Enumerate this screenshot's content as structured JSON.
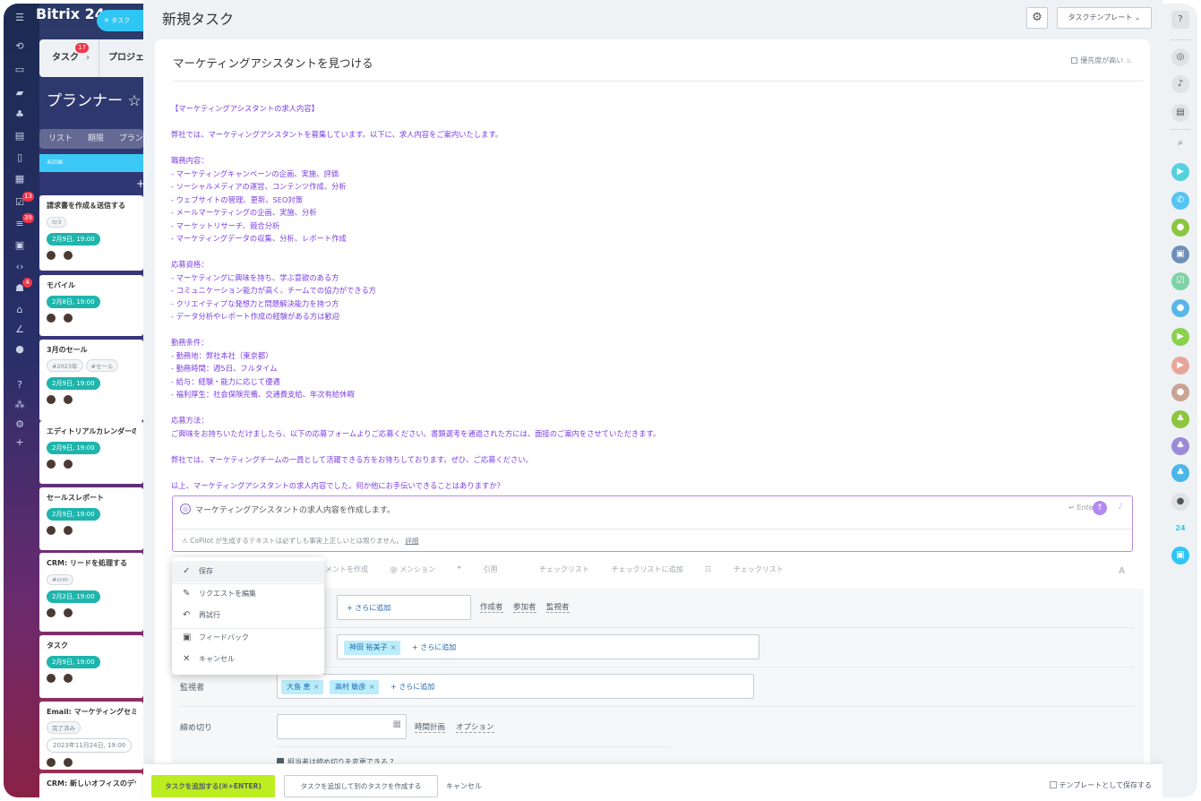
{
  "rail": {
    "brand": "Bitrix 24",
    "chip_label": "タスク",
    "counters": [
      "13",
      "39",
      "4"
    ]
  },
  "planner": {
    "tabs": [
      "タスク",
      "プロジェ"
    ],
    "tab_counter": "17",
    "title": "プランナー",
    "views": "リスト 期限 プラン",
    "column": "未計画",
    "cards": [
      {
        "title": "請求書を作成＆送信する",
        "tag": "0/3",
        "date": "2月9日, 19:00"
      },
      {
        "title": "モバイル",
        "date": "2月8日, 19:00"
      },
      {
        "title": "3月のセール",
        "tags": [
          "#2023年",
          "#セール"
        ],
        "date": "2月9日, 19:00"
      },
      {
        "title": "エディトリアルカレンダーの作",
        "date": "2月9日, 19:00"
      },
      {
        "title": "セールスレポート",
        "date": "2月9日, 19:00"
      },
      {
        "title": "CRM: リードを処理する",
        "tag": "#crm",
        "date": "2月2日, 19:00"
      },
      {
        "title": "タスク",
        "date": "2月9日, 19:00"
      },
      {
        "title": "Email: マーケティングセミナ",
        "tag": "完了済み",
        "date": "2023年11月24日, 19:00"
      },
      {
        "title": "CRM: 新しいオフィスのデザ"
      }
    ]
  },
  "main": {
    "header": "新規タスク",
    "template_button": "タスクテンプレート",
    "task_title": "マーケティングアシスタントを見つける",
    "priority_label": "優先度が高い",
    "ai_text": "【マーケティングアシスタントの求人内容】\n\n弊社では、マーケティングアシスタントを募集しています。以下に、求人内容をご案内いたします。\n\n職務内容：\n- マーケティングキャンペーンの企画、実施、評価\n- ソーシャルメディアの運営、コンテンツ作成、分析\n- ウェブサイトの管理、更新、SEO対策\n- メールマーケティングの企画、実施、分析\n- マーケットリサーチ、競合分析\n- マーケティングデータの収集、分析、レポート作成\n\n応募資格：\n- マーケティングに興味を持ち、学ぶ意欲のある方\n- コミュニケーション能力が高く、チームでの協力ができる方\n- クリエイティブな発想力と問題解決能力を持つ方\n- データ分析やレポート作成の経験がある方は歓迎\n\n勤務条件：\n- 勤務地：弊社本社（東京都）\n- 勤務時間：週5日、フルタイム\n- 給与：経験・能力に応じて優遇\n- 福利厚生：社会保険完備、交通費支給、年次有給休暇\n\n応募方法：\nご興味をお持ちいただけましたら、以下の応募フォームよりご応募ください。書類選考を通過された方には、面接のご案内をさせていただきます。\n\n弊社では、マーケティングチームの一員として活躍できる方をお待ちしております。ぜひ、ご応募ください。\n\n以上、マーケティングアシスタントの求人内容でした。何か他にお手伝いできることはありますか？",
    "copilot_input": "マーケティングアシスタントの求人内容を作成します。",
    "enter_hint": "Enter",
    "disclaimer": "CoPilot が生成するテキストは必ずしも事実上正しいとは限りません。",
    "disclaimer_link": "詳細",
    "editor_bar": [
      "メントを作成",
      "@ メンション",
      "引用",
      "チェックリスト",
      "チェックリストに追加",
      "チェックリスト"
    ],
    "menu": [
      "保存",
      "リクエストを編集",
      "再試行",
      "フィードバック",
      "キャンセル"
    ],
    "fields": {
      "add_more": "+ さらに追加",
      "role_links": [
        "作成者",
        "参加者",
        "監視者"
      ],
      "assignee": "神田 裕美子",
      "observer_label": "監視者",
      "observers": [
        "大島 恵",
        "高村 敏彦"
      ],
      "deadline_label": "締め切り",
      "deadline_links": [
        "時間計画",
        "オプション"
      ],
      "allow_change": "担当者は締め切りを変更できる"
    }
  },
  "footer": {
    "add": "タスクを追加する(⌘+ENTER)",
    "add_another": "タスクを追加して別のタスクを作成する",
    "cancel": "キャンセル",
    "save_template": "テンプレートとして保存する"
  },
  "colors": {
    "accent": "#2fc6f6",
    "ai_text": "#7b3fe4",
    "primary_button": "#bbed21"
  }
}
